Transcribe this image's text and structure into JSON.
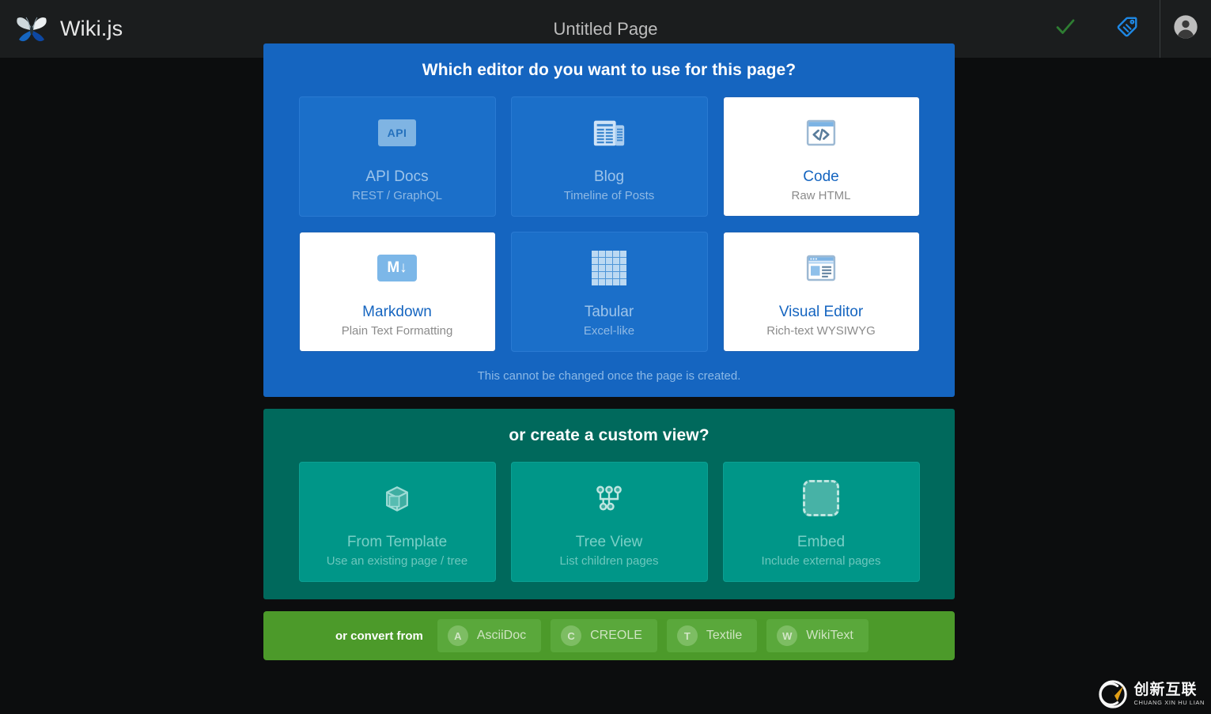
{
  "topbar": {
    "brand": "Wiki.js",
    "logo_icon": "wikijs-butterfly-logo",
    "page_title": "Untitled Page",
    "actions": [
      {
        "name": "save-check-icon",
        "icon": "check-icon",
        "label": ""
      },
      {
        "name": "tags-icon",
        "icon": "tag-icon",
        "label": ""
      }
    ],
    "account_icon": "account-circle-icon"
  },
  "editor_panel": {
    "heading": "Which editor do you want to use for this page?",
    "note": "This cannot be changed once the page is created.",
    "cards": [
      {
        "id": "api-docs",
        "title": "API Docs",
        "subtitle": "REST / GraphQL",
        "icon": "api-badge-icon",
        "state": "disabled"
      },
      {
        "id": "blog",
        "title": "Blog",
        "subtitle": "Timeline of Posts",
        "icon": "newspaper-icon",
        "state": "disabled"
      },
      {
        "id": "code",
        "title": "Code",
        "subtitle": "Raw HTML",
        "icon": "code-tags-icon",
        "state": "enabled"
      },
      {
        "id": "markdown",
        "title": "Markdown",
        "subtitle": "Plain Text Formatting",
        "icon": "markdown-badge-icon",
        "state": "enabled"
      },
      {
        "id": "tabular",
        "title": "Tabular",
        "subtitle": "Excel-like",
        "icon": "table-grid-icon",
        "state": "disabled"
      },
      {
        "id": "visual-editor",
        "title": "Visual Editor",
        "subtitle": "Rich-text WYSIWYG",
        "icon": "wysiwyg-window-icon",
        "state": "enabled"
      }
    ]
  },
  "custom_panel": {
    "heading": "or create a custom view?",
    "cards": [
      {
        "id": "from-template",
        "title": "From Template",
        "subtitle": "Use an existing page / tree",
        "icon": "cube-icon",
        "state": "disabled"
      },
      {
        "id": "tree-view",
        "title": "Tree View",
        "subtitle": "List children pages",
        "icon": "sitemap-icon",
        "state": "disabled"
      },
      {
        "id": "embed",
        "title": "Embed",
        "subtitle": "Include external pages",
        "icon": "dashed-square-icon",
        "state": "disabled"
      }
    ]
  },
  "convert_panel": {
    "label": "or convert from",
    "buttons": [
      {
        "id": "asciidoc",
        "badge": "A",
        "label": "AsciiDoc"
      },
      {
        "id": "creole",
        "badge": "C",
        "label": "CREOLE"
      },
      {
        "id": "textile",
        "badge": "T",
        "label": "Textile"
      },
      {
        "id": "wikitext",
        "badge": "W",
        "label": "WikiText"
      }
    ]
  },
  "watermark": {
    "cn": "创新互联",
    "en": "CHUANG XIN HU LIAN"
  },
  "colors": {
    "topbar_bg": "#1b1d1e",
    "backdrop": "#0c0d0e",
    "blue_panel": "#1565c0",
    "blue_card": "#1b6fc9",
    "teal_panel": "#00695c",
    "teal_card": "#009688",
    "green_panel": "#4c9a2a",
    "green_button": "#5aa83b",
    "accent_white": "#ffffff",
    "check_green": "#2e7d32",
    "tag_blue": "#1e88e5"
  }
}
